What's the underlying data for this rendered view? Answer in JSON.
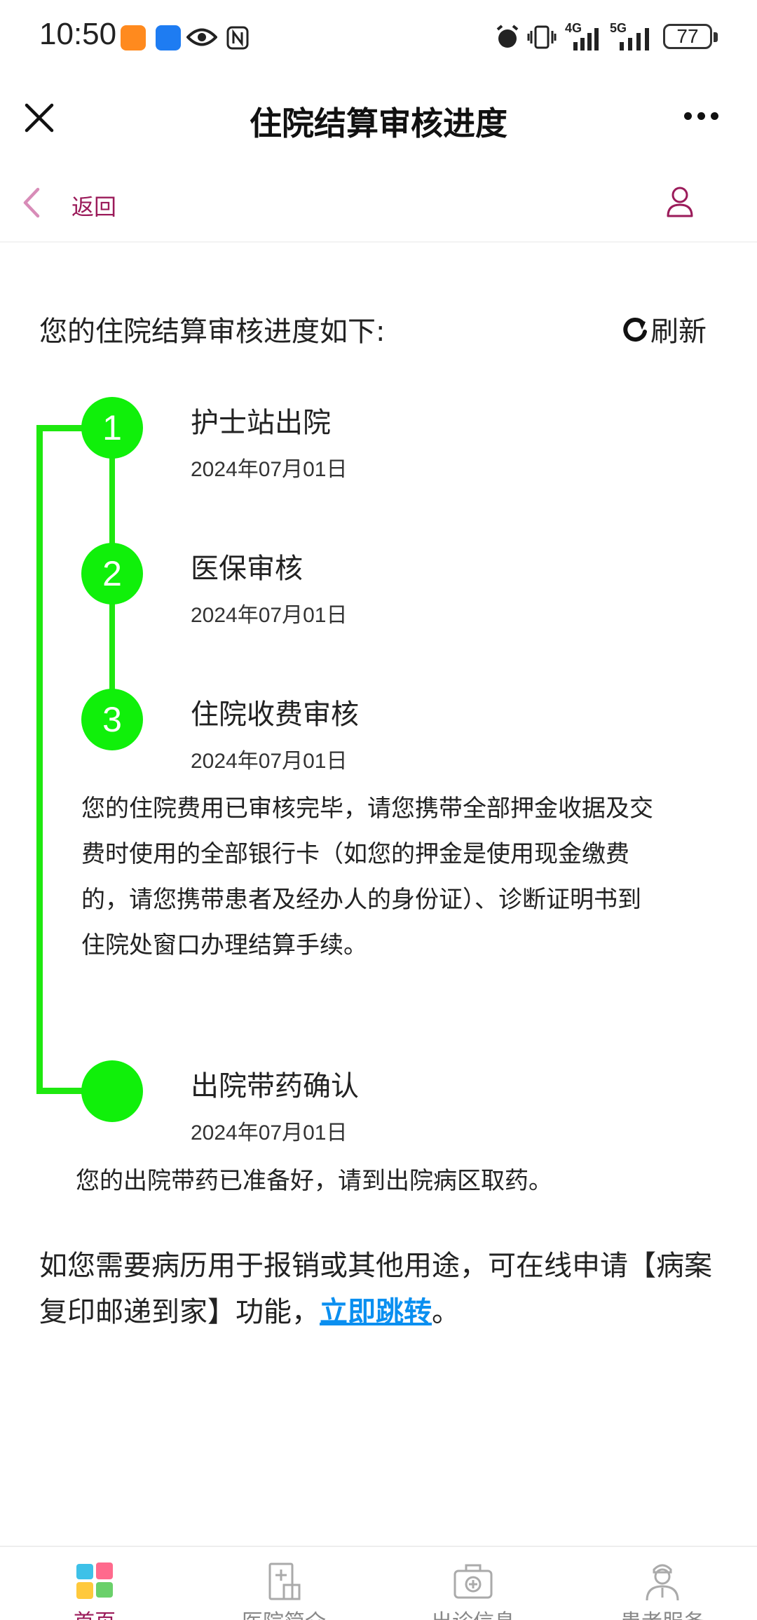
{
  "status_bar": {
    "time": "10:50",
    "network_1": "4G",
    "network_2": "5G",
    "battery": "77"
  },
  "title_bar": {
    "title": "住院结算审核进度"
  },
  "sub_nav": {
    "back_label": "返回"
  },
  "content": {
    "intro": "您的住院结算审核进度如下:",
    "refresh_label": "刷新",
    "steps": [
      {
        "number": "1",
        "title": "护士站出院",
        "date": "2024年07月01日",
        "desc": ""
      },
      {
        "number": "2",
        "title": "医保审核",
        "date": "2024年07月01日",
        "desc": ""
      },
      {
        "number": "3",
        "title": "住院收费审核",
        "date": "2024年07月01日",
        "desc": "您的住院费用已审核完毕，请您携带全部押金收据及交费时使用的全部银行卡（如您的押金是使用现金缴费的，请您携带患者及经办人的身份证）、诊断证明书到住院处窗口办理结算手续。"
      },
      {
        "number": "",
        "title": "出院带药确认",
        "date": "2024年07月01日",
        "desc": "您的出院带药已准备好，请到出院病区取药。"
      }
    ],
    "footnote_text": "如您需要病历用于报销或其他用途，可在线申请【病案复印邮递到家】功能，",
    "footnote_link": "立即跳转",
    "footnote_end": "。"
  },
  "tabs": [
    {
      "label": "首页",
      "icon": "home-icon",
      "active": true
    },
    {
      "label": "医院简介",
      "icon": "hospital-icon",
      "active": false
    },
    {
      "label": "出诊信息",
      "icon": "medical-kit-icon",
      "active": false
    },
    {
      "label": "患者服务",
      "icon": "doctor-icon",
      "active": false
    }
  ],
  "colors": {
    "accent": "#9b1b5a",
    "timeline_green": "#10f00a",
    "link_blue": "#0a8ff0"
  }
}
